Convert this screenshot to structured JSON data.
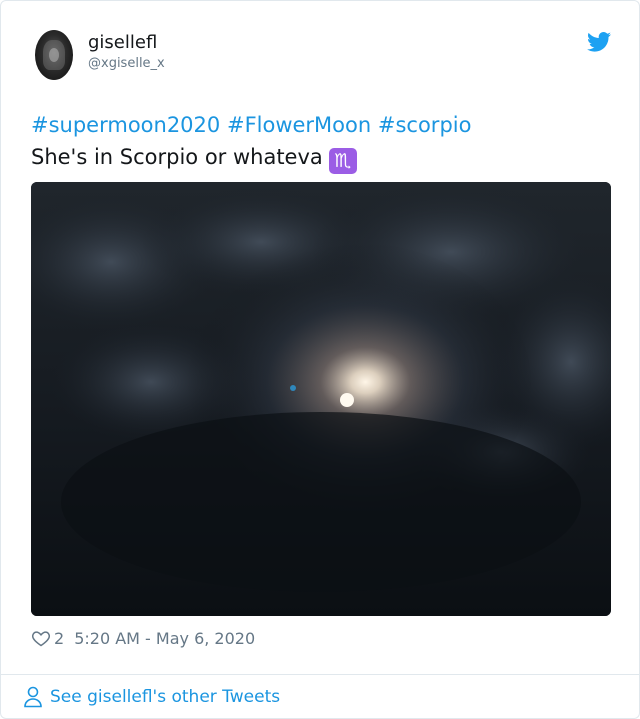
{
  "tweet": {
    "author": {
      "display_name": "gisellefl",
      "handle": "@xgiselle_x",
      "avatar_icon": "profile-photo"
    },
    "hashtags": [
      "#supermoon2020",
      "#FlowerMoon",
      "#scorpio"
    ],
    "text": "She's in Scorpio or whateva",
    "emoji": "♏",
    "emoji_color": "#9b5de5",
    "media": {
      "description": "photo",
      "kind": "photo"
    },
    "likes": "2",
    "timestamp": "5:20 AM - May 6, 2020",
    "footer_link": "See gisellefl's other Tweets",
    "colors": {
      "link": "#1b95e0",
      "muted": "#657786",
      "text": "#14171a"
    },
    "icons": {
      "brand": "twitter-bird-icon",
      "like": "heart-icon",
      "footer": "person-icon"
    }
  }
}
